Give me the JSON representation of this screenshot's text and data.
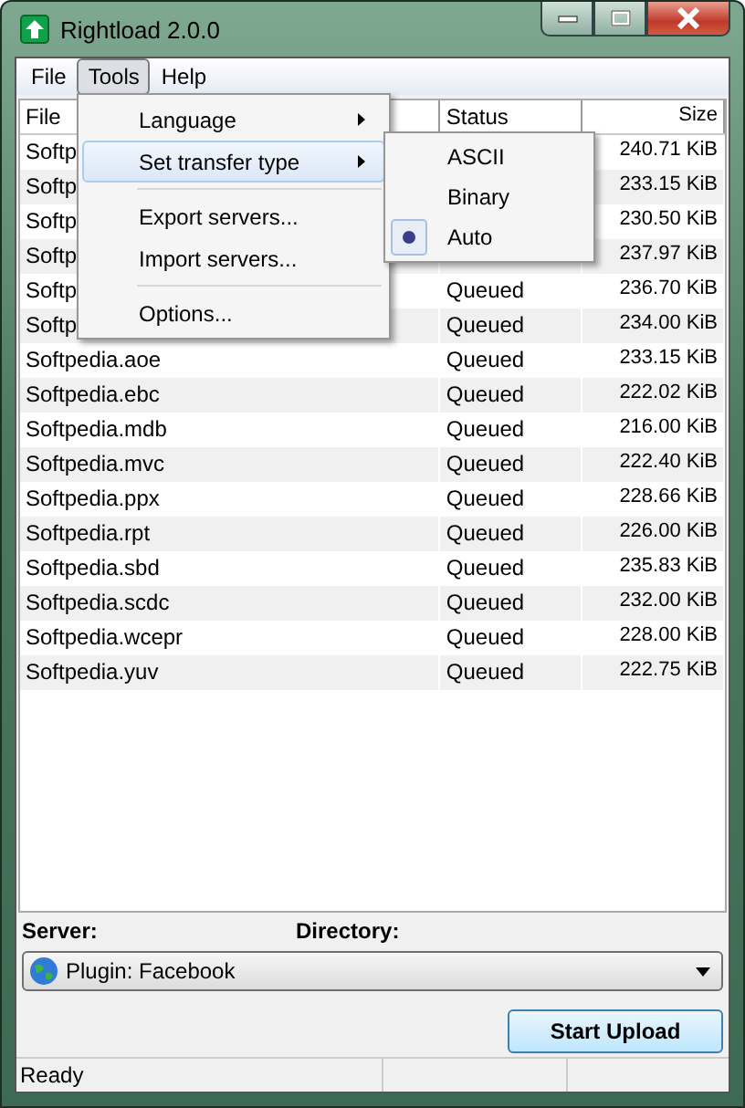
{
  "window": {
    "title": "Rightload 2.0.0"
  },
  "menubar": [
    {
      "label": "File",
      "selected": false
    },
    {
      "label": "Tools",
      "selected": true
    },
    {
      "label": "Help",
      "selected": false
    }
  ],
  "tools_menu": [
    {
      "kind": "item",
      "label": "Language",
      "submenu": true,
      "selected": false
    },
    {
      "kind": "item",
      "label": "Set transfer type",
      "submenu": true,
      "selected": true
    },
    {
      "kind": "separator"
    },
    {
      "kind": "item",
      "label": "Export servers...",
      "submenu": false,
      "selected": false
    },
    {
      "kind": "item",
      "label": "Import servers...",
      "submenu": false,
      "selected": false
    },
    {
      "kind": "separator"
    },
    {
      "kind": "item",
      "label": "Options...",
      "submenu": false,
      "selected": false
    }
  ],
  "transfer_submenu": [
    {
      "label": "ASCII",
      "checked": false
    },
    {
      "label": "Binary",
      "checked": false
    },
    {
      "label": "Auto",
      "checked": true
    }
  ],
  "table": {
    "columns": [
      "File",
      "Status",
      "Size"
    ],
    "rows": [
      {
        "file": "Softp",
        "size": "240.71 KiB"
      },
      {
        "file": "Softp",
        "size": "233.15 KiB"
      },
      {
        "file": "Softp",
        "size": "230.50 KiB"
      },
      {
        "file": "Softp",
        "size": "237.97 KiB"
      },
      {
        "file": "Softp",
        "status": "Queued",
        "size": "236.70 KiB"
      },
      {
        "file": "Softp",
        "status": "Queued",
        "size": "234.00 KiB"
      },
      {
        "file": "Softpedia.aoe",
        "status": "Queued",
        "size": "233.15 KiB"
      },
      {
        "file": "Softpedia.ebc",
        "status": "Queued",
        "size": "222.02 KiB"
      },
      {
        "file": "Softpedia.mdb",
        "status": "Queued",
        "size": "216.00 KiB"
      },
      {
        "file": "Softpedia.mvc",
        "status": "Queued",
        "size": "222.40 KiB"
      },
      {
        "file": "Softpedia.ppx",
        "status": "Queued",
        "size": "228.66 KiB"
      },
      {
        "file": "Softpedia.rpt",
        "status": "Queued",
        "size": "226.00 KiB"
      },
      {
        "file": "Softpedia.sbd",
        "status": "Queued",
        "size": "235.83 KiB"
      },
      {
        "file": "Softpedia.scdc",
        "status": "Queued",
        "size": "232.00 KiB"
      },
      {
        "file": "Softpedia.wcepr",
        "status": "Queued",
        "size": "228.00 KiB"
      },
      {
        "file": "Softpedia.yuv",
        "status": "Queued",
        "size": "222.75 KiB"
      }
    ]
  },
  "server_label": "Server:",
  "directory_label": "Directory:",
  "server_select": {
    "value": "Plugin: Facebook"
  },
  "start_button": "Start Upload",
  "status_bar": "Ready"
}
